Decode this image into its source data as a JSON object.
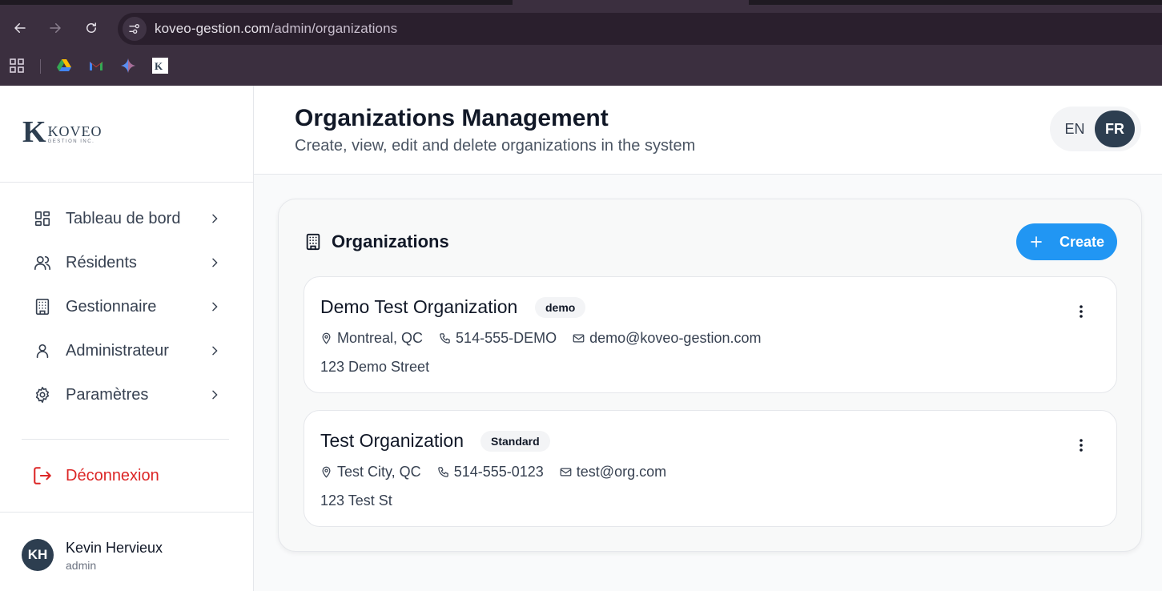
{
  "browser": {
    "url_host": "koveo-gestion.com",
    "url_path": "/admin/organizations",
    "bookmarks": [
      "apps-icon",
      "google-drive-icon",
      "gmail-icon",
      "gemini-icon",
      "koveo-favicon"
    ]
  },
  "sidebar": {
    "logo": {
      "letter": "K",
      "brand": "KOVEO",
      "sub": "GESTION INC."
    },
    "items": [
      {
        "label": "Tableau de bord",
        "icon": "dashboard-icon"
      },
      {
        "label": "Résidents",
        "icon": "users-icon"
      },
      {
        "label": "Gestionnaire",
        "icon": "building-icon"
      },
      {
        "label": "Administrateur",
        "icon": "user-icon"
      },
      {
        "label": "Paramètres",
        "icon": "gear-icon"
      }
    ],
    "logout_label": "Déconnexion",
    "user": {
      "initials": "KH",
      "name": "Kevin Hervieux",
      "role": "admin"
    }
  },
  "header": {
    "title": "Organizations Management",
    "subtitle": "Create, view, edit and delete organizations in the system",
    "lang": {
      "en": "EN",
      "fr": "FR",
      "active": "FR"
    }
  },
  "orgs_card": {
    "title": "Organizations",
    "create_label": "Create",
    "organizations": [
      {
        "name": "Demo Test Organization",
        "badge": "demo",
        "city": "Montreal, QC",
        "phone": "514-555-DEMO",
        "email": "demo@koveo-gestion.com",
        "address": "123 Demo Street"
      },
      {
        "name": "Test Organization",
        "badge": "Standard",
        "city": "Test City, QC",
        "phone": "514-555-0123",
        "email": "test@org.com",
        "address": "123 Test St"
      }
    ]
  },
  "colors": {
    "accent": "#2196f3",
    "brand_dark": "#2d3e50",
    "danger": "#dc2626",
    "chrome_bg": "#3b2f3f"
  }
}
